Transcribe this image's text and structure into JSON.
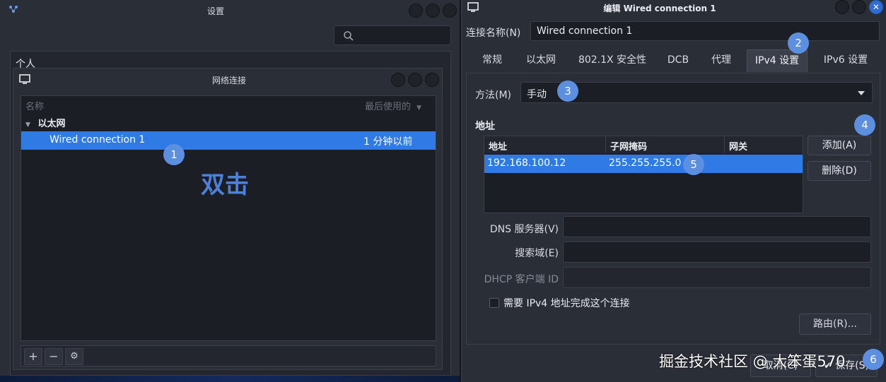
{
  "settings_window": {
    "title": "设置",
    "section_label": "个人"
  },
  "network_window": {
    "title": "网络连接",
    "columns": {
      "name": "名称",
      "last_used": "最后使用的"
    },
    "group": "以太网",
    "connection": {
      "name": "Wired connection 1",
      "last_used": "1 分钟以前"
    },
    "toolbar": {
      "add": "+",
      "remove": "−",
      "settings": "⚙"
    }
  },
  "edit_window": {
    "title": "编辑 Wired connection 1",
    "conn_name_label": "连接名称(N)",
    "conn_name_value": "Wired connection 1",
    "tabs": [
      "常规",
      "以太网",
      "802.1X 安全性",
      "DCB",
      "代理",
      "IPv4 设置",
      "IPv6 设置"
    ],
    "active_tab": "IPv4 设置",
    "method_label": "方法(M)",
    "method_value": "手动",
    "address_heading": "地址",
    "table_headers": [
      "地址",
      "子网掩码",
      "网关"
    ],
    "rows": [
      {
        "address": "192.168.100.12",
        "netmask": "255.255.255.0",
        "gateway": ""
      }
    ],
    "add_button": "添加(A)",
    "delete_button": "删除(D)",
    "dns_label": "DNS 服务器(V)",
    "search_domain_label": "搜索域(E)",
    "dhcp_client_id_label": "DHCP 客户端 ID",
    "require_ipv4_label": "需要 IPv4 地址完成这个连接",
    "routes_button": "路由(R)...",
    "cancel_button": "取消(C)",
    "save_button": "保存(S)"
  },
  "annotations": {
    "double_click": "双击",
    "badges": [
      "1",
      "2",
      "3",
      "4",
      "5",
      "6"
    ]
  },
  "watermark": "掘金技术社区 @ 大笨蛋570"
}
